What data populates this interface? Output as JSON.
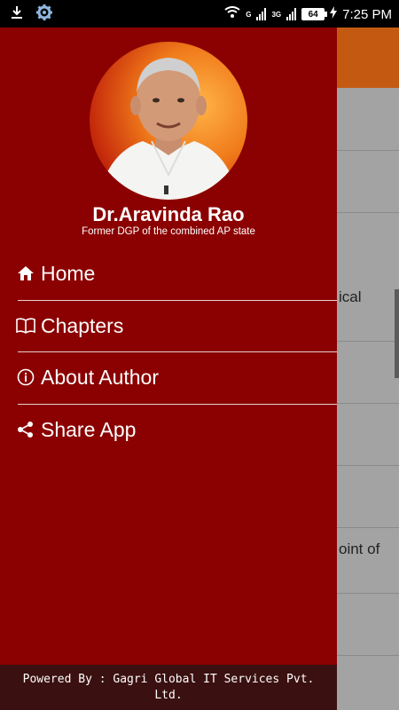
{
  "status_bar": {
    "network_type": "G",
    "network_type_2": "3G",
    "battery_level": "64",
    "time": "7:25 PM"
  },
  "drawer": {
    "author_name": "Dr.Aravinda Rao",
    "author_subtitle": "Former DGP of the combined AP state",
    "menu_items": [
      {
        "label": "Home",
        "icon": "home-icon"
      },
      {
        "label": "Chapters",
        "icon": "book-icon"
      },
      {
        "label": "About Author",
        "icon": "info-icon"
      },
      {
        "label": "Share App",
        "icon": "share-icon"
      }
    ],
    "footer": "Powered By : Gagri Global IT Services Pvt. Ltd."
  },
  "background_list": {
    "row_fragments": [
      "",
      "",
      "ical",
      "",
      "",
      "",
      "oint of",
      ""
    ]
  },
  "colors": {
    "drawer_bg": "#8b0000",
    "toolbar": "#c45a12",
    "footer_bg": "#3b1010"
  }
}
